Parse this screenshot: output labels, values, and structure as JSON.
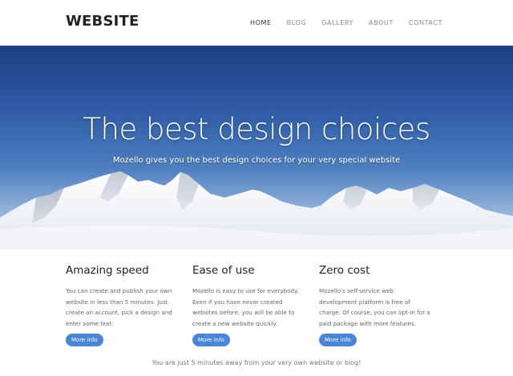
{
  "header": {
    "logo": "WEBSITE",
    "nav": [
      "HOME",
      "BLOG",
      "GALLERY",
      "ABOUT",
      "CONTACT"
    ]
  },
  "hero": {
    "title": "The best design choices",
    "subtitle": "Mozello gives you the best design choices for your very special website"
  },
  "features": [
    {
      "title": "Amazing speed",
      "text": "You can create and publish your own website in less than 5 minutes. Just create an account, pick a design and enter some text.",
      "button": "More info"
    },
    {
      "title": "Ease of use",
      "text": "Mozello is easy to use for everybody. Even if you have never created websites before, you will be able to create a new website quickly.",
      "button": "More info"
    },
    {
      "title": "Zero cost",
      "text": "Mozello's self-service web development platform is free of charge. Of course, you can opt-in for a paid package with more features.",
      "button": "More info"
    }
  ],
  "footer": {
    "text": "You are just 5 minutes away from your very own website or blog!"
  },
  "colors": {
    "accent": "#4a86d8",
    "sky_top": "#1f3f82",
    "snow": "#f4f6f8"
  }
}
